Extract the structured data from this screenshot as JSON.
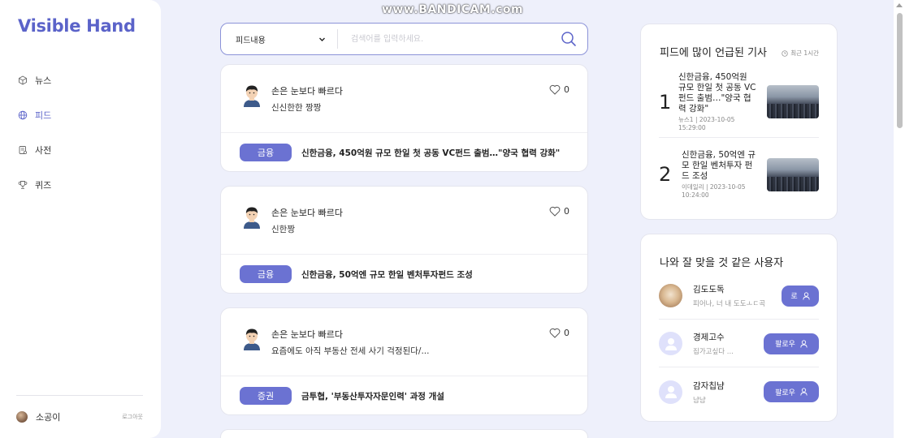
{
  "watermark": "www.BANDICAM.com",
  "app": {
    "logo": "Visible Hand"
  },
  "nav": [
    {
      "label": "뉴스",
      "icon": "cube-icon"
    },
    {
      "label": "피드",
      "icon": "globe-icon",
      "active": true
    },
    {
      "label": "사전",
      "icon": "dictionary-icon"
    },
    {
      "label": "퀴즈",
      "icon": "trophy-icon"
    }
  ],
  "current_user": {
    "name": "소공이",
    "logout": "로그아웃"
  },
  "search": {
    "select_value": "피드내용",
    "placeholder": "검색어를 입력하세요."
  },
  "feed": [
    {
      "author": "손은 눈보다 빠르다",
      "text": "신신한한 짱짱",
      "likes": "0",
      "tag": "금융",
      "headline": "신한금융, 450억원 규모 한일 첫 공동 VC펀드 출범…\"양국 협력 강화\""
    },
    {
      "author": "손은 눈보다 빠르다",
      "text": "신한짱",
      "likes": "0",
      "tag": "금융",
      "headline": "신한금융, 50억엔 규모 한일 벤처투자펀드 조성"
    },
    {
      "author": "손은 눈보다 빠르다",
      "text": "요즘에도 아직 부동산 전세 사기 걱정된다/...",
      "likes": "0",
      "tag": "증권",
      "headline": "금투협, '부동산투자자문인력' 과정 개설"
    }
  ],
  "trending": {
    "title": "피드에 많이 언급된 기사",
    "period": "최근 1시간",
    "articles": [
      {
        "rank": "1",
        "title": "신한금융, 450억원 규모 한일 첫 공동 VC펀드 출범…\"양국 협력 강화\"",
        "source": "뉴스1 | 2023-10-05",
        "time": "15:29:00"
      },
      {
        "rank": "2",
        "title": "신한금융, 50억엔 규모 한일 벤처투자 펀드 조성",
        "source": "이데일리 | 2023-10-05",
        "time": "10:24:00"
      }
    ]
  },
  "recommended": {
    "title": "나와 잘 맞을 것 같은 사용자",
    "users": [
      {
        "name": "김도도독",
        "bio": "피어나, 너 내 도도ㅗㄷ곡",
        "button": "로"
      },
      {
        "name": "경제고수",
        "bio": "집가고싶다 ...",
        "button": "팔로우"
      },
      {
        "name": "감자칩냠",
        "bio": "냠냠",
        "button": "팔로우"
      }
    ]
  },
  "colors": {
    "accent": "#6b72d2",
    "logo": "#5b63c9",
    "background": "#eef0fb"
  }
}
